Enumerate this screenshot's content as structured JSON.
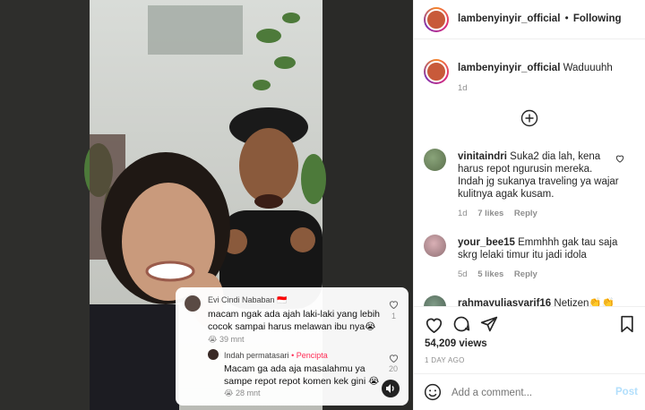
{
  "colors": {
    "link_blue": "#0095f6",
    "post_disabled": "#b2dffc",
    "pencipta_red": "#fe2c55"
  },
  "tiktok": {
    "comment1": {
      "author": "Evi Cindi Nababan",
      "flag": "🇮🇩",
      "text": "macam ngak ada ajah laki-laki yang lebih cocok sampai harus melawan ibu nya😭",
      "time": "😭 39 mnt",
      "likes": "1"
    },
    "comment2": {
      "author": "Indah permatasari",
      "creator_badge": "• Pencipta",
      "text": "Macam ga ada aja masalahmu ya sampe repot repot komen kek gini 😭",
      "time": "😭 28 mnt",
      "likes": "20"
    }
  },
  "header": {
    "username": "lambenyinyir_official",
    "separator": "•",
    "follow_status": "Following"
  },
  "caption": {
    "username": "lambenyinyir_official",
    "text": "Waduuuhh",
    "time": "1d"
  },
  "comments": [
    {
      "username": "vinitaindri",
      "text": "Suka2 dia lah, kena harus repot ngurusin mereka. Indah jg sukanya traveling ya wajar kulitnya agak kusam.",
      "time": "1d",
      "likes": "7 likes",
      "reply": "Reply"
    },
    {
      "username": "your_bee15",
      "text": "Emmhhh gak tau saja skrg lelaki timur itu jadi idola",
      "time": "5d",
      "likes": "5 likes",
      "reply": "Reply"
    },
    {
      "username": "rahmayuliasyarif16",
      "text": "Netizen👏👏",
      "time": "",
      "likes": "",
      "reply": ""
    }
  ],
  "stats": {
    "views": "54,209 views",
    "date": "1 DAY AGO"
  },
  "add_comment": {
    "placeholder": "Add a comment...",
    "post_label": "Post"
  },
  "icons": [
    "heart-icon",
    "comment-icon",
    "share-icon",
    "bookmark-icon",
    "add-comment-icon",
    "emoji-icon",
    "sound-icon"
  ]
}
